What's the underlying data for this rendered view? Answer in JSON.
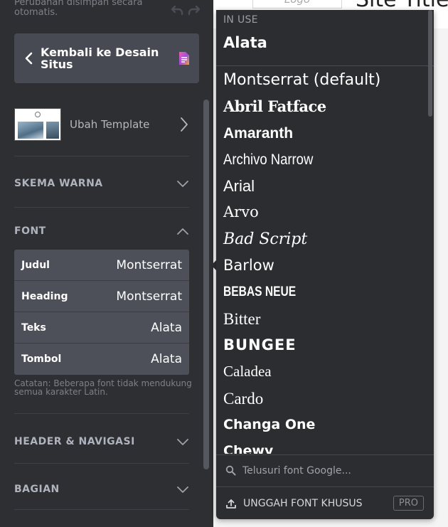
{
  "sidebar": {
    "autosave_text": "Perubahan disimpan secara otomatis.",
    "back_button_label": "Kembali ke Desain Situs",
    "template": {
      "label": "Ubah Template"
    },
    "sections": {
      "color_scheme": "SKEMA WARNA",
      "font": "FONT",
      "header_nav": "HEADER & NAVIGASI",
      "sections": "BAGIAN"
    },
    "font_rows": [
      {
        "role": "Judul",
        "value": "Montserrat"
      },
      {
        "role": "Heading",
        "value": "Montserrat"
      },
      {
        "role": "Teks",
        "value": "Alata"
      },
      {
        "role": "Tombol",
        "value": "Alata"
      }
    ],
    "note": "Catatan: Beberapa font tidak mendukung semua karakter Latin."
  },
  "preview": {
    "logo_text": "Logo",
    "site_title": "Site Title"
  },
  "dropdown": {
    "in_use_label": "IN USE",
    "in_use_font": "Alata",
    "fonts": [
      "Montserrat (default)",
      "Abril Fatface",
      "Amaranth",
      "Archivo Narrow",
      "Arial",
      "Arvo",
      "Bad Script",
      "Barlow",
      "BEBAS NEUE",
      "Bitter",
      "BUNGEE",
      "Caladea",
      "Cardo",
      "Changa One",
      "Chewy"
    ],
    "search_placeholder": "Telusuri font Google...",
    "upload_label": "UNGGAH FONT KHUSUS",
    "pro_badge": "PRO"
  },
  "colors": {
    "sidebar_bg": "#2d2f33",
    "dropdown_bg": "#2c2d31",
    "font_row_bg": "#4d5058",
    "back_button_bg": "#474a52"
  }
}
